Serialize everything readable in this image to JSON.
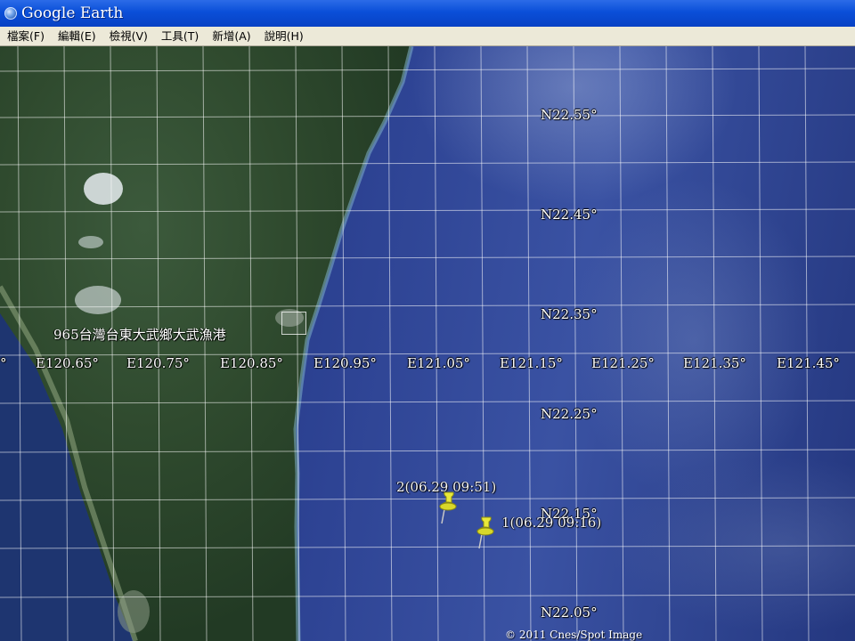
{
  "window": {
    "title": "Google Earth"
  },
  "menu": {
    "items": [
      "檔案(F)",
      "編輯(E)",
      "檢視(V)",
      "工具(T)",
      "新增(A)",
      "說明(H)"
    ]
  },
  "map": {
    "lon_labels": [
      "E120.65°",
      "E120.75°",
      "E120.85°",
      "E120.95°",
      "E121.05°",
      "E121.15°",
      "E121.25°",
      "E121.35°",
      "E121.45°"
    ],
    "lat_labels": [
      "N22.55°",
      "N22.45°",
      "N22.35°",
      "N22.25°",
      "N22.15°",
      "N22.05°"
    ],
    "place_label": "965台灣台東大武鄉大武漁港",
    "placemarks": [
      {
        "label": "2(06.29 09:51)"
      },
      {
        "label": "1(06.29 09:16)"
      }
    ],
    "copyright": "© 2011 Cnes/Spot Image"
  },
  "colors": {
    "titlebar": "#0a4fd8",
    "menubar": "#ece9d8",
    "pin": "#e8e83a"
  }
}
